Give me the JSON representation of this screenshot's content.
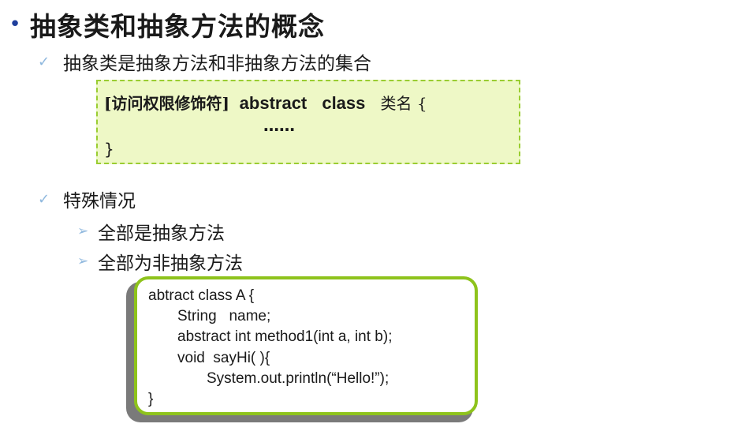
{
  "title": {
    "bullet": "•",
    "text": "抽象类和抽象方法的概念"
  },
  "points": [
    {
      "icon": "✓",
      "text": "抽象类是抽象方法和非抽象方法的集合"
    },
    {
      "icon": "✓",
      "text": "特殊情况"
    }
  ],
  "syntax_box": {
    "bracket": "[访问权限修饰符]",
    "kw1": "abstract",
    "kw2": "class",
    "classname": "类名 {",
    "ellipsis": "……",
    "close": "}"
  },
  "sub_points": [
    {
      "icon": "➢",
      "text": "全部是抽象方法"
    },
    {
      "icon": "➢",
      "text": "全部为非抽象方法"
    }
  ],
  "code_box": {
    "lines": [
      "abtract class A {",
      "String   name;",
      "abstract int method1(int a, int b);",
      "void  sayHi( ){",
      "System.out.println(“Hello!”);",
      "}"
    ]
  },
  "colors": {
    "title_bullet": "#1f3f9c",
    "check": "#8fb8de",
    "syntax_bg": "#eef8c6",
    "syntax_border": "#9acd32",
    "code_border": "#8ec31c"
  }
}
